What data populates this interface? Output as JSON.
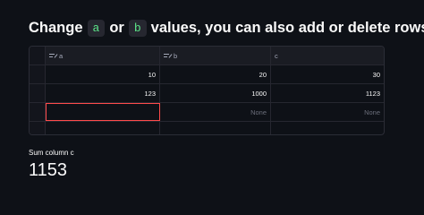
{
  "heading": {
    "part1": "Change",
    "code_a": "a",
    "part2": "or",
    "code_b": "b",
    "part3": "values, you can also add or delete rows"
  },
  "table": {
    "columns": [
      "a",
      "b",
      "c"
    ],
    "editable_columns": [
      "a",
      "b"
    ],
    "rows": [
      {
        "a": "10",
        "b": "20",
        "c": "30"
      },
      {
        "a": "123",
        "b": "1000",
        "c": "1123"
      },
      {
        "a": "",
        "b": "None",
        "c": "None"
      }
    ],
    "colors": {
      "accent_selection": "#ff4b4b",
      "code_text": "#5ce488"
    }
  },
  "metric": {
    "label": "Sum column c",
    "value": "1153"
  }
}
